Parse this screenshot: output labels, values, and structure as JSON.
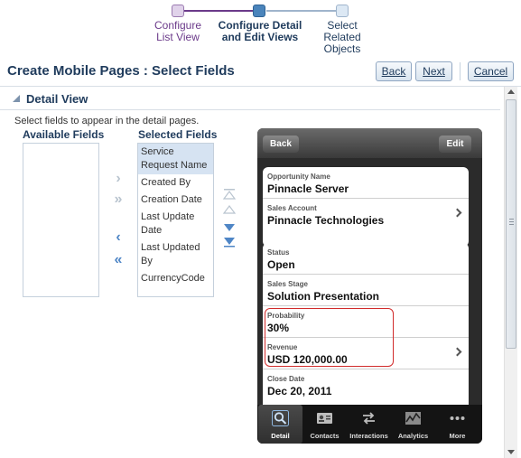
{
  "train": {
    "steps": [
      {
        "label": "Configure List View",
        "state": "visited"
      },
      {
        "label": "Configure Detail and Edit Views",
        "state": "current"
      },
      {
        "label": "Select Related Objects",
        "state": "next"
      }
    ]
  },
  "header": {
    "title": "Create Mobile Pages : Select Fields",
    "back_label": "Back",
    "next_label": "Next",
    "cancel_label": "Cancel"
  },
  "section": {
    "title": "Detail View",
    "instructions": "Select fields to appear in the detail pages."
  },
  "shuttle": {
    "available_header": "Available Fields",
    "selected_header": "Selected Fields",
    "available_items": [],
    "selected_items": [
      {
        "label": "Service Request Name",
        "selected": true
      },
      {
        "label": "Created By",
        "selected": false
      },
      {
        "label": "Creation Date",
        "selected": false
      },
      {
        "label": "Last Update Date",
        "selected": false
      },
      {
        "label": "Last Updated By",
        "selected": false
      },
      {
        "label": "CurrencyCode",
        "selected": false
      }
    ],
    "move_icon": "chevron-right",
    "move_all_icon": "double-chevron-right",
    "remove_icon": "chevron-left",
    "remove_all_icon": "double-chevron-left"
  },
  "phone": {
    "back_label": "Back",
    "edit_label": "Edit",
    "card1": [
      {
        "label": "Opportunity Name",
        "value": "Pinnacle Server",
        "chevron": false
      },
      {
        "label": "Sales Account",
        "value": "Pinnacle Technologies",
        "chevron": true
      }
    ],
    "card2": [
      {
        "label": "Status",
        "value": "Open",
        "chevron": false
      },
      {
        "label": "Sales Stage",
        "value": "Solution Presentation",
        "chevron": false
      },
      {
        "label": "Probability",
        "value": "30%",
        "chevron": false
      },
      {
        "label": "Revenue",
        "value": "USD 120,000.00",
        "chevron": true
      },
      {
        "label": "Close Date",
        "value": "Dec 20, 2011",
        "chevron": false
      }
    ],
    "tabs": [
      {
        "label": "Detail",
        "icon": "magnifier-icon",
        "active": true
      },
      {
        "label": "Contacts",
        "icon": "contact-card-icon",
        "active": false
      },
      {
        "label": "Interactions",
        "icon": "arrows-exchange-icon",
        "active": false
      },
      {
        "label": "Analytics",
        "icon": "chart-icon",
        "active": false
      },
      {
        "label": "More",
        "icon": "more-dots-icon",
        "active": false
      }
    ]
  },
  "colors": {
    "brand": "#1f3b5c",
    "accent": "#4a84bb",
    "highlight": "#d12b2b",
    "visited": "#6b3a8a"
  }
}
